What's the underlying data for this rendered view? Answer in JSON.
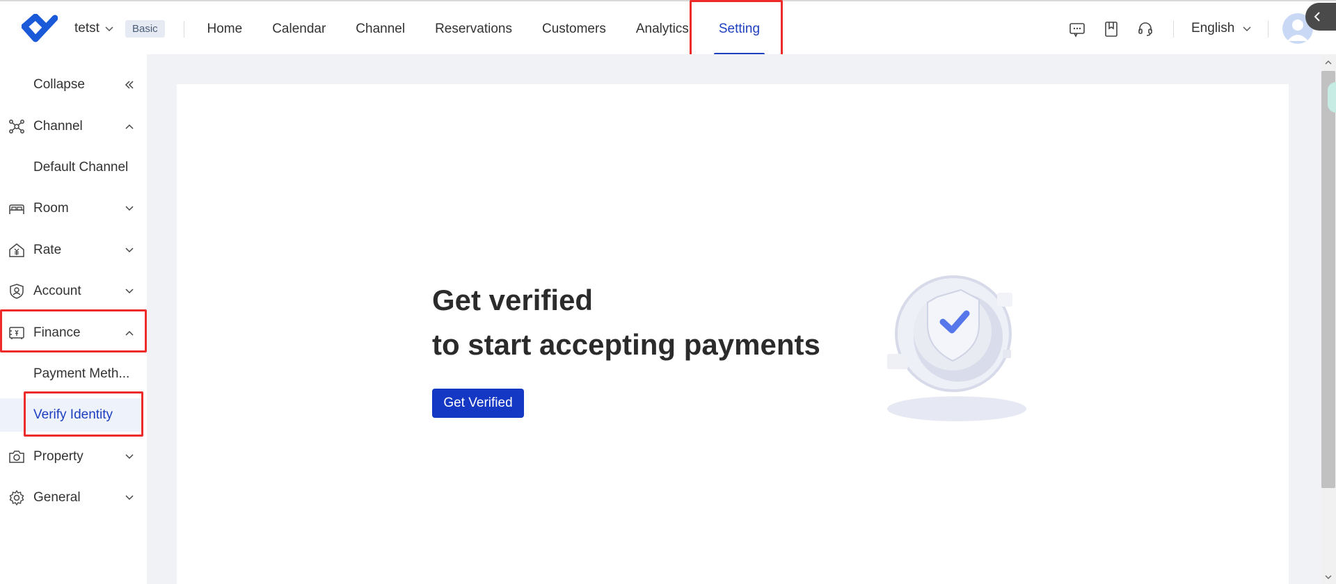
{
  "header": {
    "workspace_name": "tetst",
    "plan_badge": "Basic",
    "nav": [
      "Home",
      "Calendar",
      "Channel",
      "Reservations",
      "Customers",
      "Analytics",
      "Setting"
    ],
    "active_nav": "Setting",
    "language": "English"
  },
  "sidebar": {
    "collapse_label": "Collapse",
    "channel": "Channel",
    "default_channel": "Default Channel",
    "room": "Room",
    "rate": "Rate",
    "account": "Account",
    "finance": "Finance",
    "payment_methods": "Payment Meth...",
    "verify_identity": "Verify Identity",
    "property": "Property",
    "general": "General"
  },
  "main": {
    "title_line1": "Get verified",
    "title_line2": "to start accepting payments",
    "cta_label": "Get Verified"
  },
  "colors": {
    "accent": "#1d3fbf",
    "button": "#1438c4",
    "highlight": "#ee2b2b",
    "background": "#f1f2f5"
  }
}
